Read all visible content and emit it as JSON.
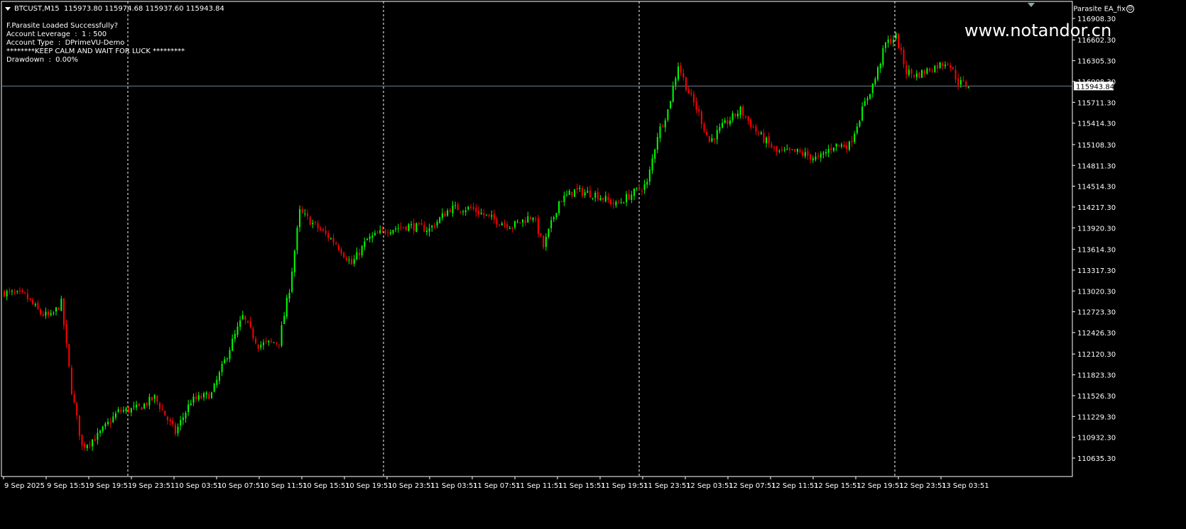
{
  "window": {
    "symbol_header": "BTCUST,M15  115973.80 115974.68 115937.60 115943.84",
    "ea_label": "Parasite EA_fix",
    "watermark": "www.notandor.cn"
  },
  "info_panel": [
    "F.Parasite Loaded Successfully?",
    "Account Leverage  :  1 : 500",
    "Account Type  :  DPrimeVU-Demo",
    "********KEEP CALM AND WAIT FOR LUCK *********",
    "Drawdown  :  0.00%"
  ],
  "colors": {
    "background": "#000000",
    "bull": "#00ff00",
    "bear": "#ff0000",
    "grid": "#ffffff",
    "price_line": "#708090",
    "axis_text": "#ffffff"
  },
  "chart_data": {
    "type": "candlestick",
    "symbol": "BTCUST",
    "timeframe": "M15",
    "current_price": 115943.84,
    "ylim": [
      110500,
      117000
    ],
    "price_ticks": [
      116908.3,
      116602.3,
      116305.3,
      116008.3,
      115711.3,
      115414.3,
      115108.3,
      114811.3,
      114514.3,
      114217.3,
      113920.3,
      113614.3,
      113317.3,
      113020.3,
      112723.3,
      112426.3,
      112120.3,
      111823.3,
      111526.3,
      111229.3,
      110932.3,
      110635.3
    ],
    "time_ticks": [
      "9 Sep 2025",
      "9 Sep 15:51",
      "9 Sep 19:51",
      "9 Sep 23:51",
      "10 Sep 03:51",
      "10 Sep 07:51",
      "10 Sep 11:51",
      "10 Sep 15:51",
      "10 Sep 19:51",
      "10 Sep 23:51",
      "11 Sep 03:51",
      "11 Sep 07:51",
      "11 Sep 11:51",
      "11 Sep 15:51",
      "11 Sep 19:51",
      "11 Sep 23:51",
      "12 Sep 03:51",
      "12 Sep 07:51",
      "12 Sep 11:51",
      "12 Sep 15:51",
      "12 Sep 19:51",
      "12 Sep 23:51",
      "13 Sep 03:51"
    ],
    "day_separators_after_tick": [
      "9 Sep 19:51",
      "10 Sep 19:51",
      "11 Sep 19:51",
      "12 Sep 19:51"
    ],
    "close_path": [
      {
        "bar": 0,
        "price": 113000
      },
      {
        "bar": 8,
        "price": 112950
      },
      {
        "bar": 14,
        "price": 112700
      },
      {
        "bar": 18,
        "price": 112650
      },
      {
        "bar": 22,
        "price": 112850
      },
      {
        "bar": 26,
        "price": 111600
      },
      {
        "bar": 30,
        "price": 110800
      },
      {
        "bar": 36,
        "price": 110950
      },
      {
        "bar": 44,
        "price": 111300
      },
      {
        "bar": 52,
        "price": 111350
      },
      {
        "bar": 58,
        "price": 111500
      },
      {
        "bar": 66,
        "price": 111000
      },
      {
        "bar": 72,
        "price": 111450
      },
      {
        "bar": 80,
        "price": 111550
      },
      {
        "bar": 88,
        "price": 112300
      },
      {
        "bar": 92,
        "price": 112650
      },
      {
        "bar": 98,
        "price": 112250
      },
      {
        "bar": 106,
        "price": 112300
      },
      {
        "bar": 110,
        "price": 113050
      },
      {
        "bar": 114,
        "price": 114150
      },
      {
        "bar": 120,
        "price": 113950
      },
      {
        "bar": 128,
        "price": 113700
      },
      {
        "bar": 134,
        "price": 113400
      },
      {
        "bar": 140,
        "price": 113750
      },
      {
        "bar": 148,
        "price": 113900
      },
      {
        "bar": 156,
        "price": 113950
      },
      {
        "bar": 164,
        "price": 113900
      },
      {
        "bar": 172,
        "price": 114200
      },
      {
        "bar": 180,
        "price": 114200
      },
      {
        "bar": 188,
        "price": 114050
      },
      {
        "bar": 196,
        "price": 113950
      },
      {
        "bar": 204,
        "price": 114100
      },
      {
        "bar": 208,
        "price": 113650
      },
      {
        "bar": 214,
        "price": 114300
      },
      {
        "bar": 220,
        "price": 114450
      },
      {
        "bar": 228,
        "price": 114400
      },
      {
        "bar": 236,
        "price": 114250
      },
      {
        "bar": 244,
        "price": 114450
      },
      {
        "bar": 248,
        "price": 114550
      },
      {
        "bar": 252,
        "price": 115250
      },
      {
        "bar": 256,
        "price": 115600
      },
      {
        "bar": 260,
        "price": 116250
      },
      {
        "bar": 264,
        "price": 115850
      },
      {
        "bar": 268,
        "price": 115550
      },
      {
        "bar": 272,
        "price": 115150
      },
      {
        "bar": 278,
        "price": 115400
      },
      {
        "bar": 284,
        "price": 115600
      },
      {
        "bar": 290,
        "price": 115300
      },
      {
        "bar": 298,
        "price": 115000
      },
      {
        "bar": 306,
        "price": 115000
      },
      {
        "bar": 314,
        "price": 114900
      },
      {
        "bar": 320,
        "price": 115100
      },
      {
        "bar": 326,
        "price": 115100
      },
      {
        "bar": 332,
        "price": 115700
      },
      {
        "bar": 336,
        "price": 116050
      },
      {
        "bar": 340,
        "price": 116550
      },
      {
        "bar": 344,
        "price": 116650
      },
      {
        "bar": 348,
        "price": 116150
      },
      {
        "bar": 352,
        "price": 116100
      },
      {
        "bar": 358,
        "price": 116200
      },
      {
        "bar": 364,
        "price": 116300
      },
      {
        "bar": 368,
        "price": 116000
      },
      {
        "bar": 372,
        "price": 115950
      }
    ]
  },
  "price_axis_labels": [
    "116908.30",
    "116602.30",
    "116305.30",
    "116008.30",
    "115711.30",
    "115414.30",
    "115108.30",
    "114811.30",
    "114514.30",
    "114217.30",
    "113920.30",
    "113614.30",
    "113317.30",
    "113020.30",
    "112723.30",
    "112426.30",
    "112120.30",
    "111823.30",
    "111526.30",
    "111229.30",
    "110932.30",
    "110635.30"
  ],
  "current_price_label": "115943.84"
}
